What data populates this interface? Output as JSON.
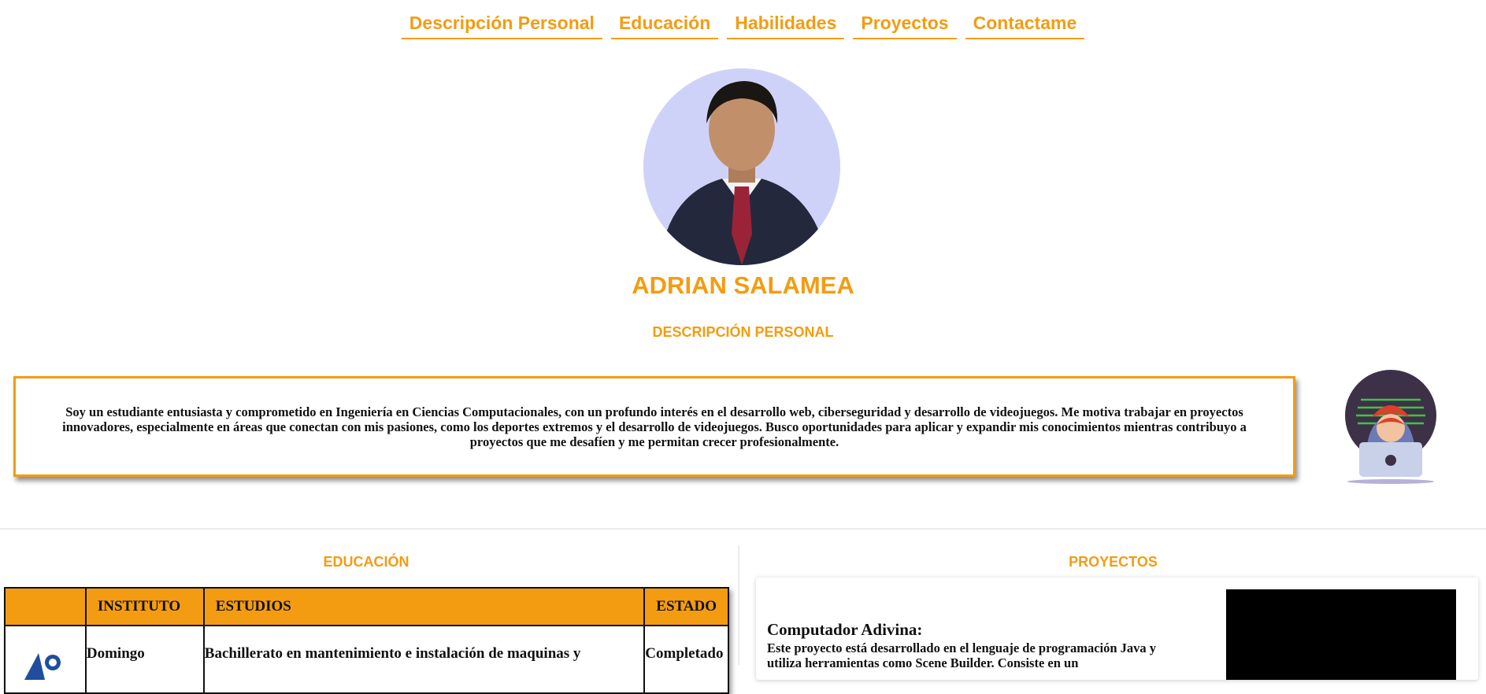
{
  "nav": {
    "items": [
      {
        "label": "Descripción Personal"
      },
      {
        "label": "Educación"
      },
      {
        "label": "Habilidades"
      },
      {
        "label": "Proyectos"
      },
      {
        "label": "Contactame"
      }
    ]
  },
  "profile": {
    "name": "ADRIAN SALAMEA"
  },
  "description": {
    "heading": "DESCRIPCIÓN PERSONAL",
    "text": "Soy un estudiante entusiasta y comprometido en Ingeniería en Ciencias Computacionales, con un profundo interés en el desarrollo web, ciberseguridad y desarrollo de videojuegos. Me motiva trabajar en proyectos innovadores, especialmente en áreas que conectan con mis pasiones, como los deportes extremos y el desarrollo de videojuegos. Busco oportunidades para aplicar y expandir mis conocimientos mientras contribuyo a proyectos que me desafíen y me permitan crecer profesionalmente."
  },
  "education": {
    "heading": "EDUCACIÓN",
    "columns": [
      "",
      "INSTITUTO",
      "ESTUDIOS",
      "ESTADO"
    ],
    "rows": [
      {
        "institute": "Domingo",
        "studies": "Bachillerato en mantenimiento e instalación de maquinas y",
        "status": "Completado"
      }
    ]
  },
  "projects": {
    "heading": "PROYECTOS",
    "items": [
      {
        "title": "Computador Adivina:",
        "text": "Este proyecto está desarrollado en el lenguaje de programación Java y utiliza herramientas como Scene Builder. Consiste en un"
      }
    ]
  },
  "colors": {
    "accent": "#f39c12",
    "avatar_bg": "#cfd2f8"
  }
}
